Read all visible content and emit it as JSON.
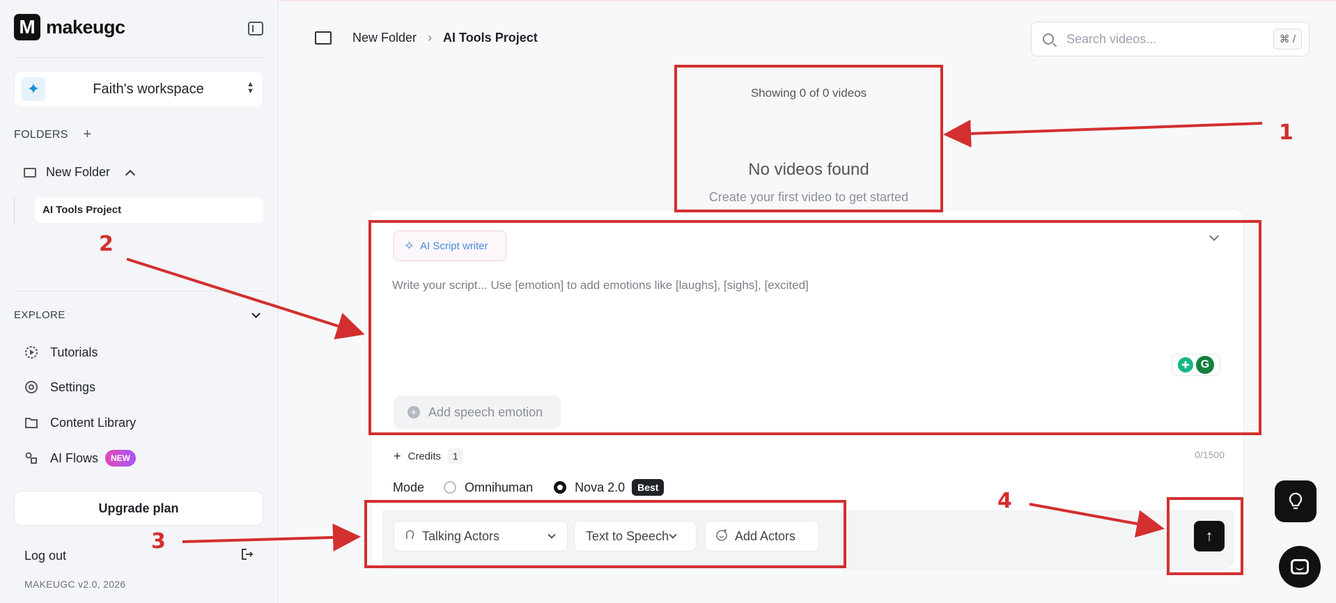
{
  "sidebar": {
    "logo_letter": "M",
    "logo_text": "makeugc",
    "workspace_icon": "✦",
    "workspace_name": "Faith's workspace",
    "folders_label": "FOLDERS",
    "folder_name": "New Folder",
    "project_name": "AI Tools Project",
    "explore_label": "EXPLORE",
    "nav": {
      "tutorials": "Tutorials",
      "settings": "Settings",
      "content_library": "Content Library",
      "ai_flows": "AI Flows",
      "new_badge": "NEW"
    },
    "upgrade_label": "Upgrade plan",
    "logout_label": "Log out",
    "version": "MAKEUGC v2.0, 2026"
  },
  "breadcrumb": {
    "folder": "New Folder",
    "separator": "›",
    "current": "AI Tools Project"
  },
  "search": {
    "placeholder": "Search videos...",
    "shortcut": "⌘ /"
  },
  "videos": {
    "showing": "Showing 0 of 0 videos",
    "empty_title": "No videos found",
    "empty_subtitle": "Create your first video to get started"
  },
  "composer": {
    "ai_writer_label": "AI Script writer",
    "script_placeholder": "Write your script... Use [emotion] to add emotions like [laughs], [sighs], [excited]",
    "add_emotion_label": "Add speech emotion",
    "credits_label": "Credits",
    "credits_value": "1",
    "char_count": "0/1500",
    "mode_label": "Mode",
    "modes": [
      {
        "label": "Omnihuman",
        "selected": false
      },
      {
        "label": "Nova 2.0",
        "selected": true
      }
    ],
    "best_badge": "Best",
    "talking_actors_label": "Talking Actors",
    "tts_label": "Text to Speech",
    "add_actors_label": "Add Actors",
    "send_icon": "↑"
  },
  "annotations": {
    "color": "#d32f2f",
    "numbers": [
      "1",
      "2",
      "3",
      "4"
    ]
  }
}
